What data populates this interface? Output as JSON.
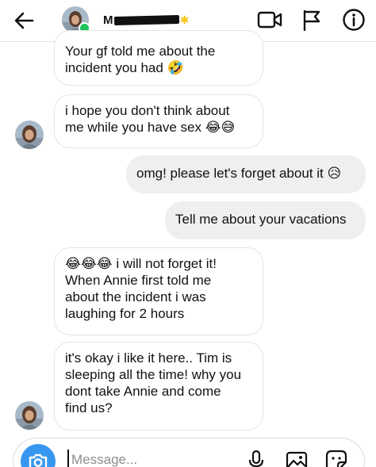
{
  "header": {
    "contact_name_visible": "M",
    "icons": {
      "back": "arrow-left-icon",
      "video": "video-call-icon",
      "flag": "flag-icon",
      "info": "info-icon"
    },
    "online_color": "#1fc35b"
  },
  "messages": [
    {
      "direction": "in",
      "text": "Your gf told me about the\nincident you had 🤣"
    },
    {
      "direction": "in",
      "text": "i hope you don't think about\nme while you have sex 😂😅"
    },
    {
      "direction": "out",
      "text": "omg! please let's forget about it 😥"
    },
    {
      "direction": "out",
      "text": "Tell me about your vacations"
    },
    {
      "direction": "in",
      "text": "😂😂😂  i will not forget it!\nWhen Annie  first told me\nabout the incident i was\nlaughing for 2 hours"
    },
    {
      "direction": "in",
      "text": "it's okay  i like it here.. Tim is\nsleeping all the time! why you\ndont take Annie and come\nfind us?"
    }
  ],
  "composer": {
    "placeholder": "Message...",
    "icons": {
      "camera": "camera-icon",
      "mic": "microphone-icon",
      "gallery": "gallery-icon",
      "sticker": "sticker-icon"
    },
    "accent": "#3797f0"
  }
}
